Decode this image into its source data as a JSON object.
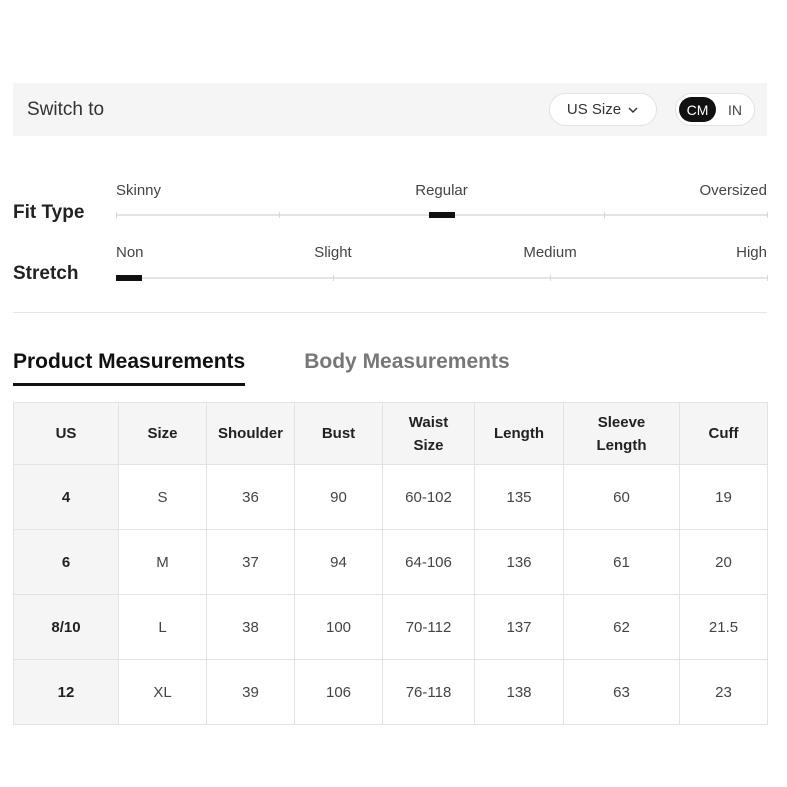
{
  "switch_bar": {
    "label": "Switch to",
    "size_system": "US Size",
    "units": {
      "active": "CM",
      "inactive": "IN"
    }
  },
  "fit_type": {
    "title": "Fit Type",
    "labels": [
      "Skinny",
      "Regular",
      "Oversized"
    ],
    "selected": "Regular",
    "level": 0.5
  },
  "stretch": {
    "title": "Stretch",
    "labels": [
      "Non",
      "Slight",
      "Medium",
      "High"
    ],
    "selected": "Non",
    "level": 0
  },
  "tabs": {
    "product": "Product Measurements",
    "body": "Body Measurements",
    "active": "product"
  },
  "table": {
    "headers": [
      [
        "US"
      ],
      [
        "Size"
      ],
      [
        "Shoulder"
      ],
      [
        "Bust"
      ],
      [
        "Waist",
        "Size"
      ],
      [
        "Length"
      ],
      [
        "Sleeve",
        "Length"
      ],
      [
        "Cuff"
      ]
    ],
    "rows": [
      [
        "4",
        "S",
        "36",
        "90",
        "60-102",
        "135",
        "60",
        "19"
      ],
      [
        "6",
        "M",
        "37",
        "94",
        "64-106",
        "136",
        "61",
        "20"
      ],
      [
        "8/10",
        "L",
        "38",
        "100",
        "70-112",
        "137",
        "62",
        "21.5"
      ],
      [
        "12",
        "XL",
        "39",
        "106",
        "76-118",
        "138",
        "63",
        "23"
      ]
    ]
  },
  "colors": {
    "accent": "#111111",
    "panel": "#f5f5f5",
    "border": "#e3e3e3",
    "inactive_tab": "#777777"
  }
}
